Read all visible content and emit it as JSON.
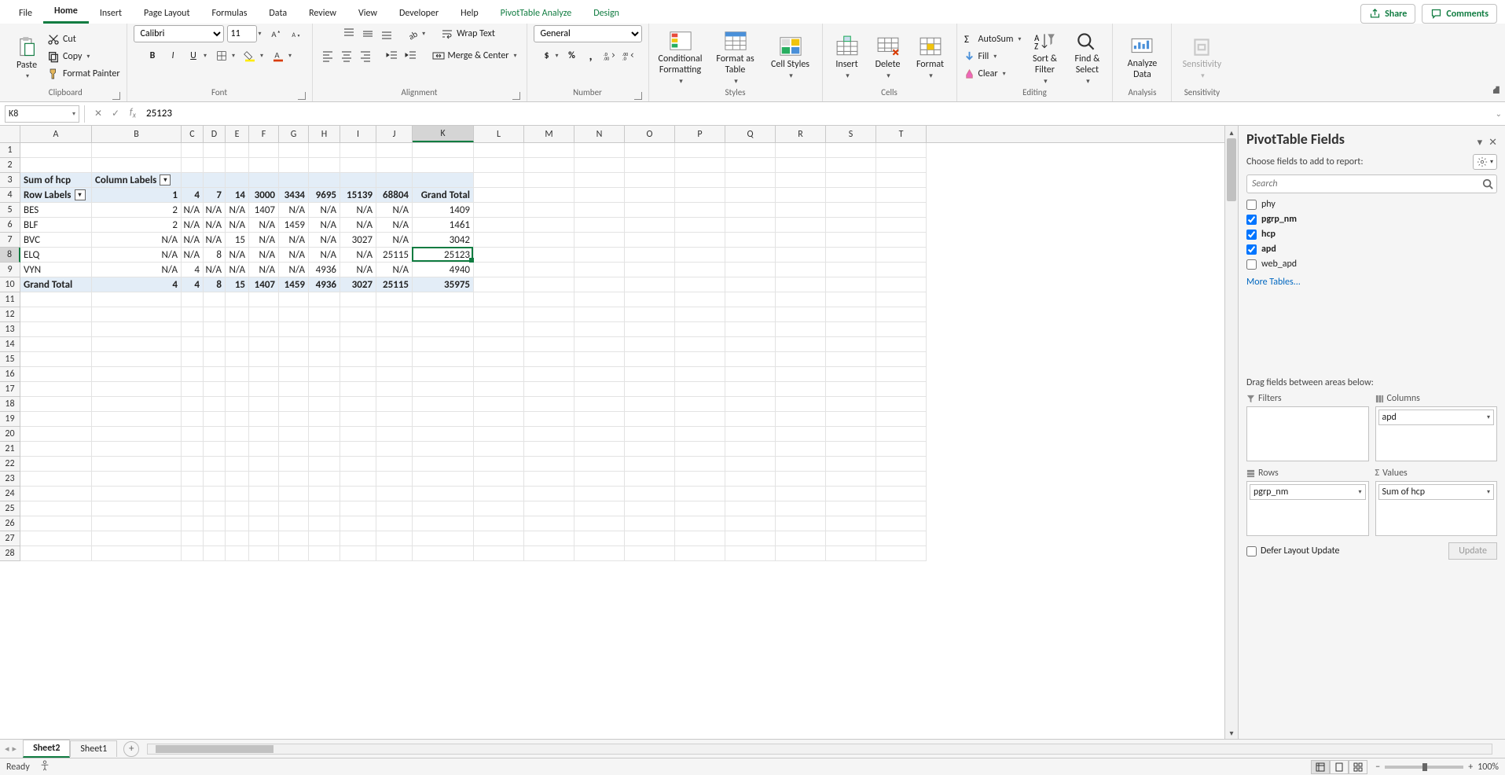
{
  "tabs": [
    "File",
    "Home",
    "Insert",
    "Page Layout",
    "Formulas",
    "Data",
    "Review",
    "View",
    "Developer",
    "Help",
    "PivotTable Analyze",
    "Design"
  ],
  "active_tab": "Home",
  "share": "Share",
  "comments": "Comments",
  "ribbon": {
    "clipboard": {
      "label": "Clipboard",
      "paste": "Paste",
      "cut": "Cut",
      "copy": "Copy",
      "fp": "Format Painter"
    },
    "font": {
      "label": "Font",
      "name": "Calibri",
      "size": "11"
    },
    "alignment": {
      "label": "Alignment",
      "wrap": "Wrap Text",
      "merge": "Merge & Center"
    },
    "number": {
      "label": "Number",
      "format": "General"
    },
    "styles": {
      "label": "Styles",
      "cf": "Conditional Formatting",
      "fat": "Format as Table",
      "cs": "Cell Styles"
    },
    "cells": {
      "label": "Cells",
      "insert": "Insert",
      "delete": "Delete",
      "format": "Format"
    },
    "editing": {
      "label": "Editing",
      "autosum": "AutoSum",
      "fill": "Fill",
      "clear": "Clear",
      "sort": "Sort & Filter",
      "find": "Find & Select"
    },
    "analysis": {
      "label": "Analysis",
      "ad": "Analyze Data"
    },
    "sensitivity": {
      "label": "Sensitivity",
      "s": "Sensitivity"
    }
  },
  "formula_bar": {
    "name_box": "K8",
    "value": "25123"
  },
  "columns": [
    "A",
    "B",
    "C",
    "D",
    "E",
    "F",
    "G",
    "H",
    "I",
    "J",
    "K",
    "L",
    "M",
    "N",
    "O",
    "P",
    "Q",
    "R",
    "S",
    "T"
  ],
  "pivot": {
    "sum_of": "Sum of hcp",
    "col_lbl": "Column Labels",
    "row_lbl": "Row Labels",
    "gt": "Grand Total",
    "col_headers": [
      "1",
      "4",
      "7",
      "14",
      "3000",
      "3434",
      "9695",
      "15139",
      "68804",
      "Grand Total"
    ],
    "rows": [
      {
        "lbl": "BES",
        "v": [
          "2",
          "N/A",
          "N/A",
          "N/A",
          "1407",
          "N/A",
          "N/A",
          "N/A",
          "N/A",
          "1409"
        ]
      },
      {
        "lbl": "BLF",
        "v": [
          "2",
          "N/A",
          "N/A",
          "N/A",
          "N/A",
          "1459",
          "N/A",
          "N/A",
          "N/A",
          "1461"
        ]
      },
      {
        "lbl": "BVC",
        "v": [
          "N/A",
          "N/A",
          "N/A",
          "15",
          "N/A",
          "N/A",
          "N/A",
          "3027",
          "N/A",
          "3042"
        ]
      },
      {
        "lbl": "ELQ",
        "v": [
          "N/A",
          "N/A",
          "8",
          "N/A",
          "N/A",
          "N/A",
          "N/A",
          "N/A",
          "25115",
          "25123"
        ]
      },
      {
        "lbl": "VYN",
        "v": [
          "N/A",
          "4",
          "N/A",
          "N/A",
          "N/A",
          "N/A",
          "4936",
          "N/A",
          "N/A",
          "4940"
        ]
      }
    ],
    "totals": [
      "4",
      "4",
      "8",
      "15",
      "1407",
      "1459",
      "4936",
      "3027",
      "25115",
      "35975"
    ]
  },
  "col_widths": {
    "A": 91,
    "B": 114,
    "C": 28,
    "D": 28,
    "E": 30,
    "F": 38,
    "G": 38,
    "H": 40,
    "I": 46,
    "J": 46,
    "K": 78,
    "L": 64,
    "M": 64,
    "N": 64,
    "O": 64,
    "P": 64,
    "Q": 64,
    "R": 64,
    "S": 64,
    "T": 64
  },
  "row_count": 28,
  "selected": {
    "row": 8,
    "col": "K"
  },
  "pane": {
    "title": "PivotTable Fields",
    "choose": "Choose fields to add to report:",
    "search_ph": "Search",
    "fields": [
      {
        "name": "phy",
        "checked": false,
        "bold": false
      },
      {
        "name": "pgrp_nm",
        "checked": true,
        "bold": true
      },
      {
        "name": "hcp",
        "checked": true,
        "bold": true
      },
      {
        "name": "apd",
        "checked": true,
        "bold": true
      },
      {
        "name": "web_apd",
        "checked": false,
        "bold": false
      }
    ],
    "more": "More Tables...",
    "drag": "Drag fields between areas below:",
    "filters": "Filters",
    "columns": "Columns",
    "rows": "Rows",
    "values": "Values",
    "col_pill": "apd",
    "row_pill": "pgrp_nm",
    "val_pill": "Sum of hcp",
    "defer": "Defer Layout Update",
    "update": "Update"
  },
  "sheets": {
    "active": "Sheet2",
    "tabs": [
      "Sheet2",
      "Sheet1"
    ]
  },
  "status": {
    "ready": "Ready",
    "zoom": "100%"
  }
}
